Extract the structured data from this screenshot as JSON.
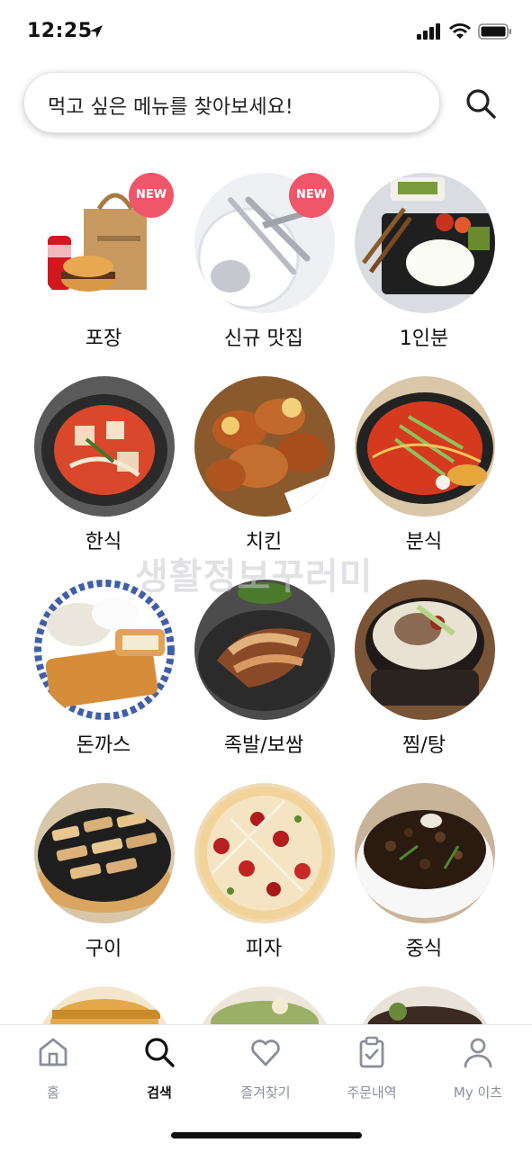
{
  "status_bar": {
    "time": "12:25",
    "icons": [
      "location-arrow-icon",
      "signal-icon",
      "wifi-icon",
      "battery-icon"
    ]
  },
  "search": {
    "placeholder": "먹고 싶은 메뉴를 찾아보세요!",
    "icon": "search-icon"
  },
  "badge_label": "NEW",
  "categories": [
    {
      "label": "포장",
      "new": true
    },
    {
      "label": "신규 맛집",
      "new": true
    },
    {
      "label": "1인분",
      "new": false
    },
    {
      "label": "한식",
      "new": false
    },
    {
      "label": "치킨",
      "new": false
    },
    {
      "label": "분식",
      "new": false
    },
    {
      "label": "돈까스",
      "new": false
    },
    {
      "label": "족발/보쌈",
      "new": false
    },
    {
      "label": "찜/탕",
      "new": false
    },
    {
      "label": "구이",
      "new": false
    },
    {
      "label": "피자",
      "new": false
    },
    {
      "label": "중식",
      "new": false
    }
  ],
  "watermark": "생활정보꾸러미",
  "tabbar": {
    "items": [
      {
        "label": "홈",
        "icon": "home-icon",
        "active": false
      },
      {
        "label": "검색",
        "icon": "search-icon",
        "active": true
      },
      {
        "label": "즐겨찾기",
        "icon": "heart-icon",
        "active": false
      },
      {
        "label": "주문내역",
        "icon": "clipboard-icon",
        "active": false
      },
      {
        "label": "My 이츠",
        "icon": "person-icon",
        "active": false
      }
    ]
  },
  "colors": {
    "accent": "#f0566a",
    "tab_inactive": "#8a8f99",
    "tab_active": "#111111"
  }
}
